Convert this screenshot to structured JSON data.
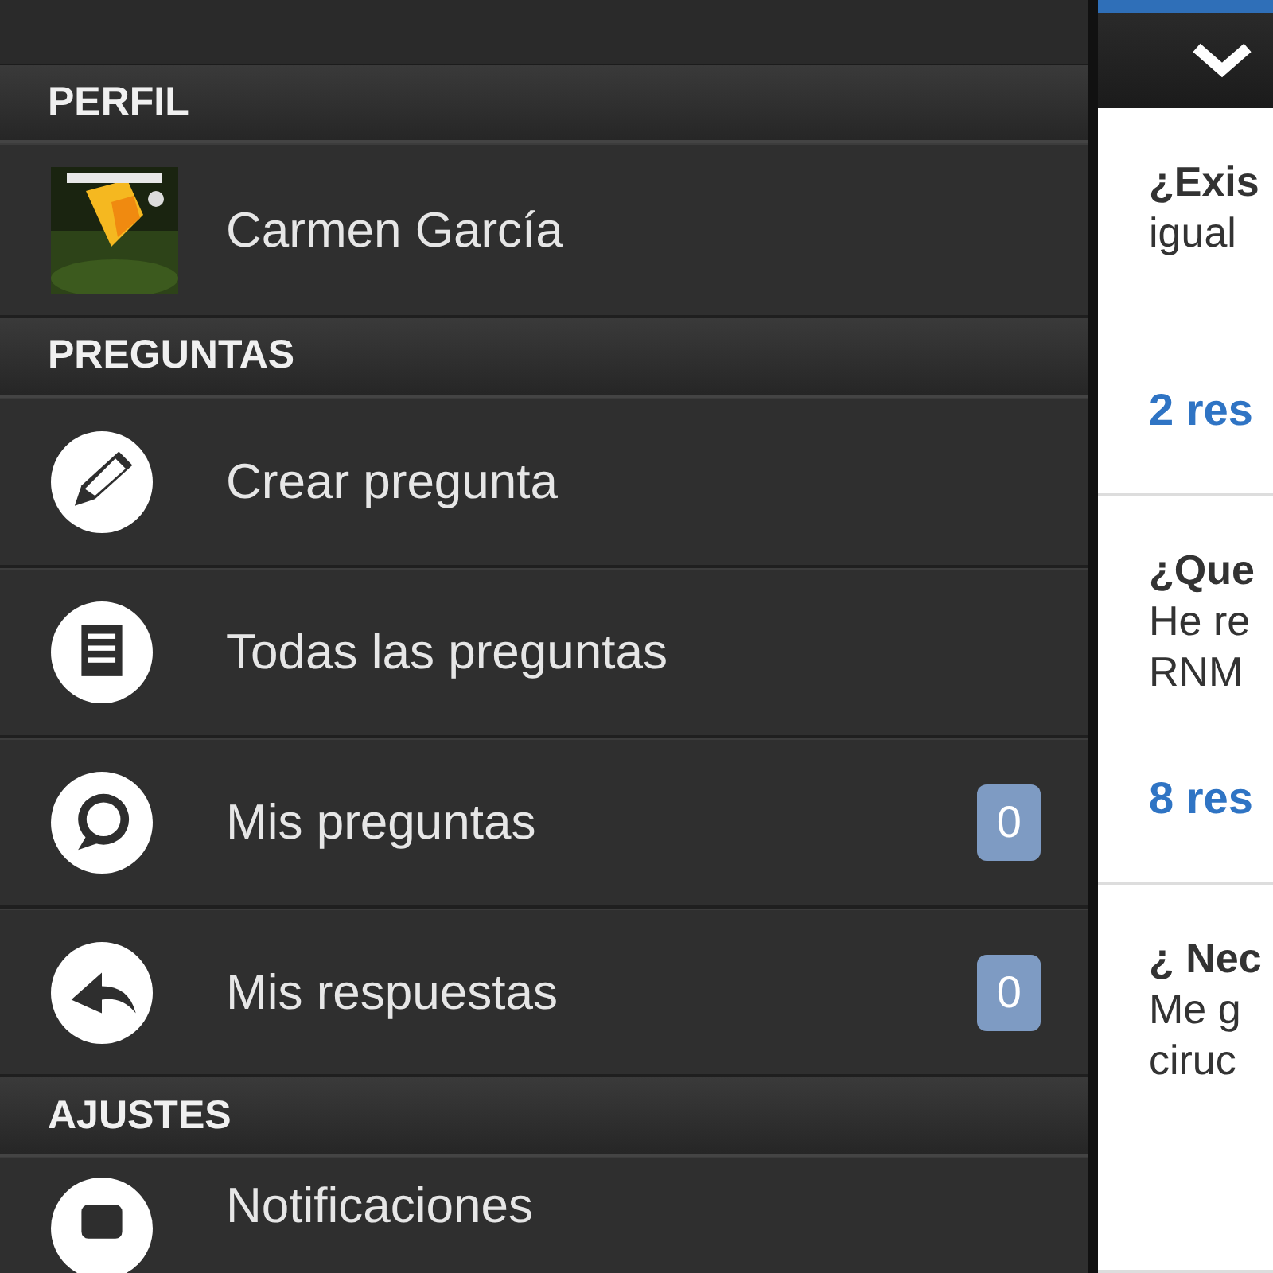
{
  "sections": [
    {
      "kind": "profile",
      "title": "PERFIL",
      "items": [
        {
          "label": "Carmen García"
        }
      ]
    },
    {
      "kind": "menu",
      "title": "PREGUNTAS",
      "items": [
        {
          "label": "Crear pregunta"
        },
        {
          "label": "Todas las preguntas"
        },
        {
          "label": "Mis preguntas",
          "badge": "0"
        },
        {
          "label": "Mis respuestas",
          "badge": "0"
        }
      ]
    },
    {
      "kind": "menu",
      "title": "AJUSTES",
      "items": [
        {
          "label": "Notificaciones"
        }
      ]
    }
  ],
  "questions": [
    {
      "lines": [
        "¿Exis",
        "igual"
      ],
      "answers": "2 res"
    },
    {
      "lines": [
        "¿Que",
        "He re",
        "RNM"
      ],
      "answers": "8 res"
    },
    {
      "lines": [
        "¿ Nec",
        "Me g",
        "ciruc"
      ]
    }
  ]
}
